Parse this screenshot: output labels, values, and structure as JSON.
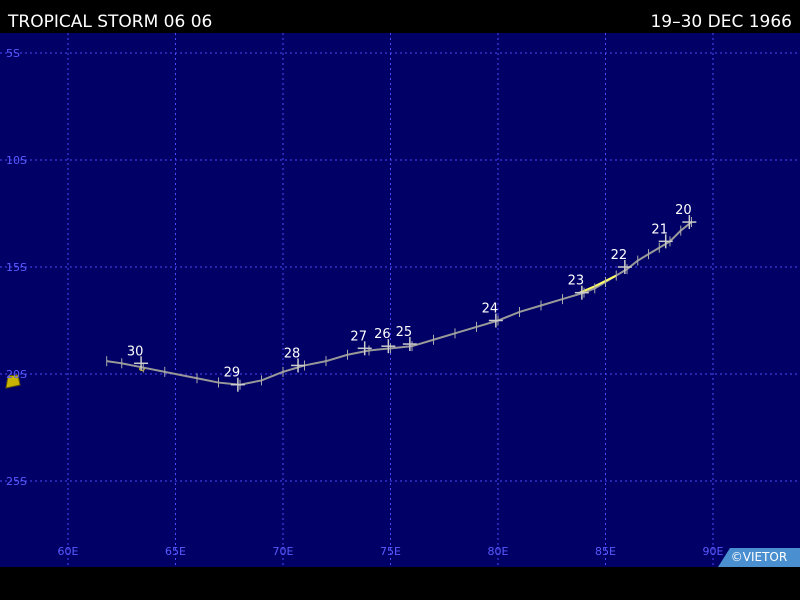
{
  "header": {
    "storm_name": "TROPICAL STORM 06 06",
    "date_range": "19–30 DEC 1966"
  },
  "map": {
    "lon_labels": [
      "60E",
      "65E",
      "70E",
      "75E",
      "80E",
      "85E",
      "90E"
    ],
    "lat_labels": [
      "5S",
      "10S",
      "15S",
      "20S",
      "25S"
    ],
    "lon_values": [
      60,
      65,
      70,
      75,
      80,
      85,
      90
    ],
    "lat_values": [
      5,
      10,
      15,
      20,
      25
    ],
    "colors": {
      "ocean": "#000066",
      "grid": "#4a4aff",
      "axis_label": "#5a5aff",
      "track": "#999999",
      "track_storm": "#ffff66",
      "day_label": "#ffffff",
      "land": "#c8b400"
    },
    "track_lonlat": [
      [
        89.0,
        -12.9
      ],
      [
        88.5,
        -13.3
      ],
      [
        88.0,
        -13.8
      ],
      [
        87.5,
        -14.1
      ],
      [
        87.0,
        -14.4
      ],
      [
        86.5,
        -14.7
      ],
      [
        86.0,
        -15.1
      ],
      [
        85.5,
        -15.4
      ],
      [
        85.0,
        -15.7
      ],
      [
        84.5,
        -16.0
      ],
      [
        84.0,
        -16.2
      ],
      [
        83.0,
        -16.5
      ],
      [
        82.0,
        -16.8
      ],
      [
        81.0,
        -17.1
      ],
      [
        80.0,
        -17.5
      ],
      [
        79.0,
        -17.8
      ],
      [
        78.0,
        -18.1
      ],
      [
        77.0,
        -18.4
      ],
      [
        76.0,
        -18.7
      ],
      [
        75.0,
        -18.8
      ],
      [
        74.0,
        -18.9
      ],
      [
        73.0,
        -19.1
      ],
      [
        72.0,
        -19.4
      ],
      [
        71.0,
        -19.6
      ],
      [
        70.0,
        -19.9
      ],
      [
        69.0,
        -20.3
      ],
      [
        68.0,
        -20.5
      ],
      [
        67.0,
        -20.4
      ],
      [
        66.0,
        -20.2
      ],
      [
        64.5,
        -19.9
      ],
      [
        63.5,
        -19.7
      ],
      [
        62.5,
        -19.5
      ],
      [
        61.8,
        -19.4
      ]
    ],
    "storm_segment": [
      [
        85.5,
        -15.4
      ],
      [
        84.5,
        -15.9
      ],
      [
        83.8,
        -16.2
      ]
    ],
    "day_marks": [
      {
        "label": "20",
        "lon": 88.9,
        "lat": -12.9
      },
      {
        "label": "21",
        "lon": 87.8,
        "lat": -13.8
      },
      {
        "label": "22",
        "lon": 85.9,
        "lat": -15.0
      },
      {
        "label": "23",
        "lon": 83.9,
        "lat": -16.2
      },
      {
        "label": "24",
        "lon": 79.9,
        "lat": -17.5
      },
      {
        "label": "25",
        "lon": 75.9,
        "lat": -18.6
      },
      {
        "label": "26",
        "lon": 74.9,
        "lat": -18.7
      },
      {
        "label": "27",
        "lon": 73.8,
        "lat": -18.8
      },
      {
        "label": "28",
        "lon": 70.7,
        "lat": -19.6
      },
      {
        "label": "29",
        "lon": 67.9,
        "lat": -20.5
      },
      {
        "label": "30",
        "lon": 63.4,
        "lat": -19.5
      }
    ],
    "credit": "©VIETOR"
  }
}
